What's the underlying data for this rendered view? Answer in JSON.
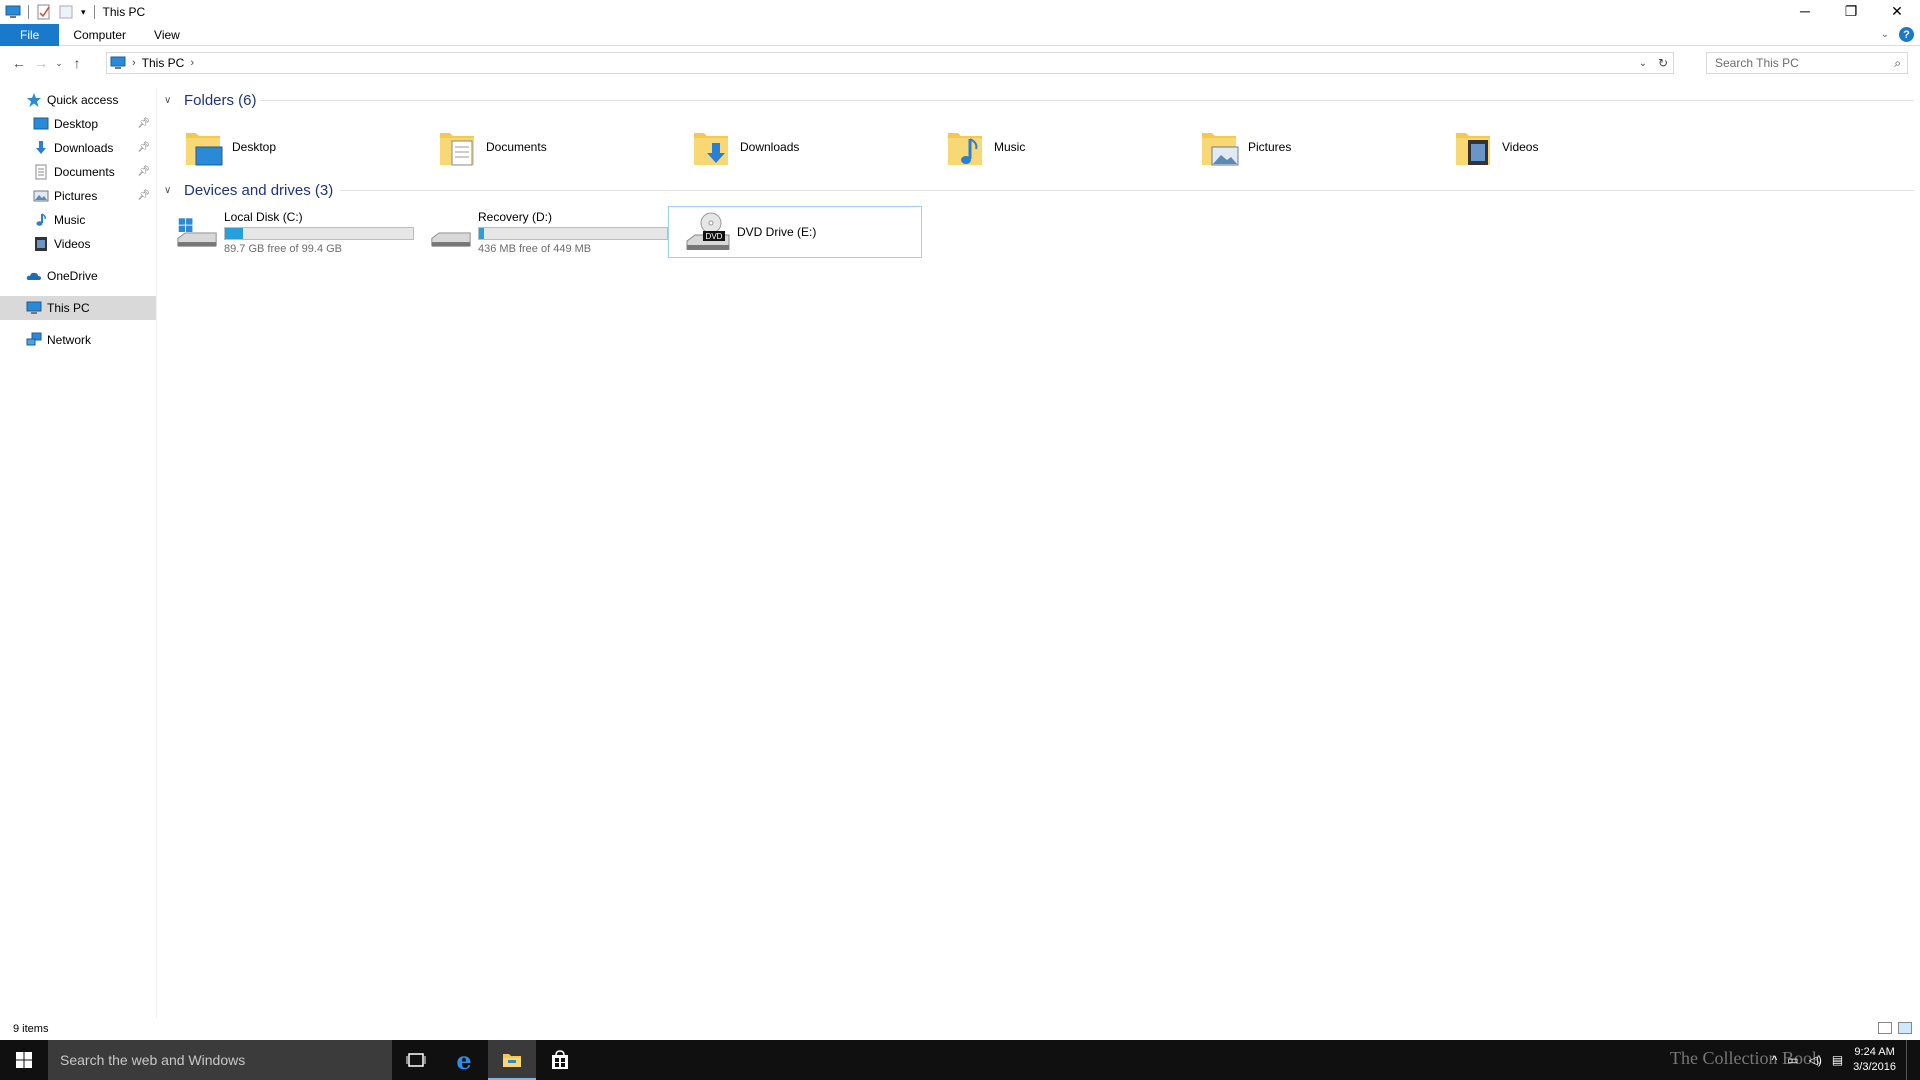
{
  "window": {
    "title": "This PC",
    "controls": {
      "minimize": "─",
      "maximize": "❐",
      "close": "✕"
    }
  },
  "ribbon": {
    "tabs": [
      "File",
      "Computer",
      "View"
    ],
    "help": "?"
  },
  "address": {
    "location": "This PC",
    "search_placeholder": "Search This PC"
  },
  "sidebar": {
    "quick_access": "Quick access",
    "quick_items": [
      {
        "label": "Desktop",
        "icon": "desktop-icon",
        "pinned": true
      },
      {
        "label": "Downloads",
        "icon": "downloads-icon",
        "pinned": true
      },
      {
        "label": "Documents",
        "icon": "documents-icon",
        "pinned": true
      },
      {
        "label": "Pictures",
        "icon": "pictures-icon",
        "pinned": true
      },
      {
        "label": "Music",
        "icon": "music-icon",
        "pinned": false
      },
      {
        "label": "Videos",
        "icon": "videos-icon",
        "pinned": false
      }
    ],
    "onedrive": "OneDrive",
    "this_pc": "This PC",
    "network": "Network"
  },
  "content": {
    "folders_header": "Folders (6)",
    "folders": [
      "Desktop",
      "Documents",
      "Downloads",
      "Music",
      "Pictures",
      "Videos"
    ],
    "drives_header": "Devices and drives (3)",
    "drives": [
      {
        "name": "Local Disk (C:)",
        "free": "89.7 GB free of 99.4 GB",
        "used_fraction": 0.098
      },
      {
        "name": "Recovery (D:)",
        "free": "436 MB free of 449 MB",
        "used_fraction": 0.029
      },
      {
        "name": "DVD Drive (E:)"
      }
    ]
  },
  "status": {
    "items": "9 items"
  },
  "taskbar": {
    "search": "Search the web and Windows",
    "time": "9:24 AM",
    "date": "3/3/2016",
    "watermark": "The Collection Book"
  },
  "colors": {
    "accent": "#1979ca",
    "selection": "#d9d9d9",
    "group_header": "#1e3287",
    "bar_fill": "#26a0da"
  }
}
